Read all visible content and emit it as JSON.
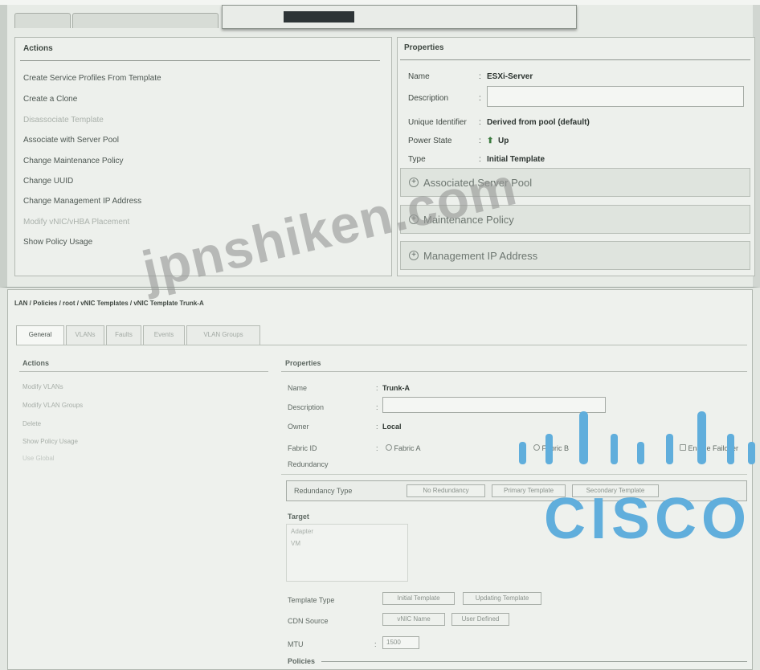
{
  "top_panel": {
    "actions": {
      "header": "Actions",
      "items": [
        {
          "label": "Create Service Profiles From Template",
          "enabled": true
        },
        {
          "label": "Create a Clone",
          "enabled": true
        },
        {
          "label": "Disassociate Template",
          "enabled": false
        },
        {
          "label": "Associate with Server Pool",
          "enabled": true
        },
        {
          "label": "Change Maintenance Policy",
          "enabled": true
        },
        {
          "label": "Change UUID",
          "enabled": true
        },
        {
          "label": "Change Management IP Address",
          "enabled": true
        },
        {
          "label": "Modify vNIC/vHBA Placement",
          "enabled": false
        },
        {
          "label": "Show Policy Usage",
          "enabled": true
        }
      ]
    },
    "properties": {
      "header": "Properties",
      "name_label": "Name",
      "name_value": "ESXi-Server",
      "description_label": "Description",
      "description_value": "",
      "uuid_label": "Unique Identifier",
      "uuid_value": "Derived from pool (default)",
      "power_label": "Power State",
      "power_value": "Up",
      "type_label": "Type",
      "type_value": "Initial Template",
      "sections": [
        {
          "label": "Associated Server Pool"
        },
        {
          "label": "Maintenance Policy"
        },
        {
          "label": "Management IP Address"
        }
      ]
    }
  },
  "bottom_panel": {
    "breadcrumb": "LAN / Policies / root / vNIC Templates / vNIC Template Trunk-A",
    "tabs": [
      "General",
      "VLANs",
      "Faults",
      "Events",
      "VLAN Groups"
    ],
    "actions": {
      "header": "Actions",
      "items": [
        {
          "label": "Modify VLANs",
          "enabled": true
        },
        {
          "label": "Modify VLAN Groups",
          "enabled": true
        },
        {
          "label": "Delete",
          "enabled": true
        },
        {
          "label": "Show Policy Usage",
          "enabled": true
        },
        {
          "label": "Use Global",
          "enabled": false
        }
      ]
    },
    "properties": {
      "header": "Properties",
      "name_label": "Name",
      "name_value": "Trunk-A",
      "description_label": "Description",
      "description_value": "",
      "owner_label": "Owner",
      "owner_value": "Local",
      "fabric_label": "Fabric ID",
      "redundancy_label": "Redundancy",
      "fabric_options": [
        "Fabric A",
        "Fabric B",
        "Enable Failover"
      ],
      "redundancy_type_label": "Redundancy Type",
      "redundancy_options": [
        "No Redundancy",
        "Primary Template",
        "Secondary Template"
      ],
      "target_label": "Target",
      "target_options": [
        "Adapter",
        "VM"
      ],
      "template_type_label": "Template Type",
      "template_type_options": [
        "Initial Template",
        "Updating Template"
      ],
      "cdn_label": "CDN Source",
      "cdn_options": [
        "vNIC Name",
        "User Defined"
      ],
      "mtu_label": "MTU",
      "mtu_value": "1500",
      "policies_label": "Policies"
    }
  },
  "watermark_text": "jpnshiken.com",
  "logo": {
    "word": "CISCO",
    "color": "#60aedc"
  }
}
